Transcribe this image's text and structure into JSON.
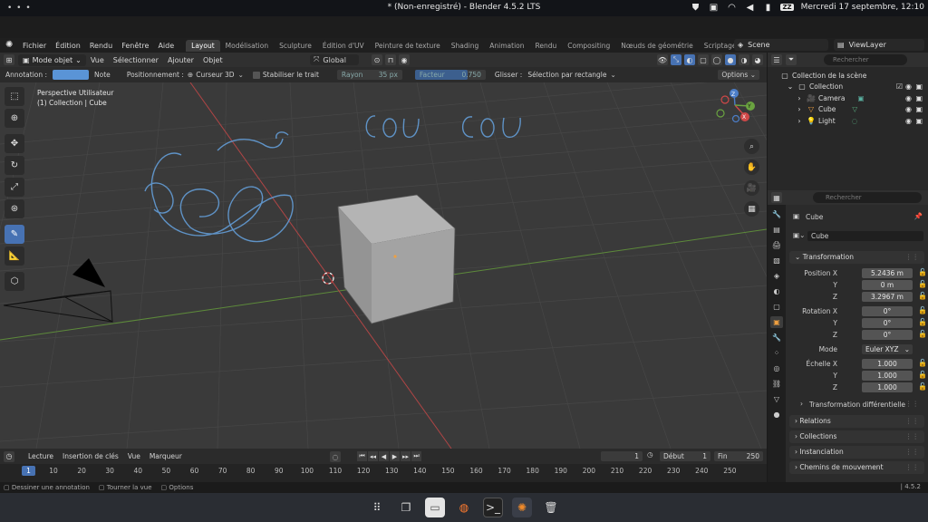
{
  "os": {
    "dots": "• • •",
    "window_title": "* (Non-enregistré) - Blender 4.5.2 LTS",
    "badge": "ZZ",
    "datetime": "Mercredi 17 septembre, 12:10"
  },
  "top_menu": {
    "items": [
      "Fichier",
      "Édition",
      "Rendu",
      "Fenêtre",
      "Aide"
    ],
    "workspaces": [
      "Layout",
      "Modélisation",
      "Sculpture",
      "Édition d'UV",
      "Peinture de texture",
      "Shading",
      "Animation",
      "Rendu",
      "Compositing",
      "Nœuds de géométrie",
      "Scriptage"
    ],
    "active_workspace": "Layout",
    "scene": "Scene",
    "view_layer": "ViewLayer"
  },
  "header": {
    "mode": "Mode objet",
    "menus": [
      "Vue",
      "Sélectionner",
      "Ajouter",
      "Objet"
    ],
    "orientation": "Global"
  },
  "tool_settings": {
    "annotation_label": "Annotation :",
    "note_label": "Note",
    "placement_label": "Positionnement :",
    "placement_value": "Curseur 3D",
    "stabilize_label": "Stabiliser le trait",
    "radius_label": "Rayon",
    "radius_value": "35 px",
    "factor_label": "Facteur",
    "factor_value": "0.750",
    "factor_fraction": 0.75,
    "slide_label": "Glisser :",
    "slide_value": "Sélection par rectangle",
    "options_label": "Options",
    "accent_color": "#5a94d6"
  },
  "viewport": {
    "view_name": "Perspective Utilisateur",
    "context": "(1) Collection | Cube",
    "annotation_text": "COU COU",
    "background": "#3a3a3a"
  },
  "outliner": {
    "search_placeholder": "Rechercher",
    "root": "Collection de la scène",
    "collection": "Collection",
    "objects": [
      "Camera",
      "Cube",
      "Light"
    ]
  },
  "properties": {
    "search_placeholder": "Rechercher",
    "object_name_header": "Cube",
    "object_name_field": "Cube",
    "transform_title": "Transformation",
    "position_label": "Position X",
    "position": [
      "5.2436 m",
      "0 m",
      "3.2967 m"
    ],
    "rotation_label": "Rotation X",
    "rotation": [
      "0°",
      "0°",
      "0°"
    ],
    "axis_y": "Y",
    "axis_z": "Z",
    "mode_label": "Mode",
    "mode_value": "Euler XYZ",
    "scale_label": "Échelle X",
    "scale": [
      "1.000",
      "1.000",
      "1.000"
    ],
    "delta_title": "Transformation différentielle",
    "sections": [
      "Relations",
      "Collections",
      "Instanciation",
      "Chemins de mouvement"
    ]
  },
  "timeline": {
    "menus": [
      "Lecture",
      "Insertion de clés",
      "Vue",
      "Marqueur"
    ],
    "current_frame": "1",
    "start_label": "Début",
    "start_value": "1",
    "end_label": "Fin",
    "end_value": "250",
    "ruler": [
      "1",
      "10",
      "20",
      "30",
      "40",
      "50",
      "60",
      "70",
      "80",
      "90",
      "100",
      "110",
      "120",
      "130",
      "140",
      "150",
      "160",
      "170",
      "180",
      "190",
      "200",
      "210",
      "220",
      "230",
      "240",
      "250"
    ]
  },
  "statusbar": {
    "hint1": "Dessiner une annotation",
    "hint2": "Tourner la vue",
    "hint3": "Options",
    "version": "4.5.2"
  }
}
